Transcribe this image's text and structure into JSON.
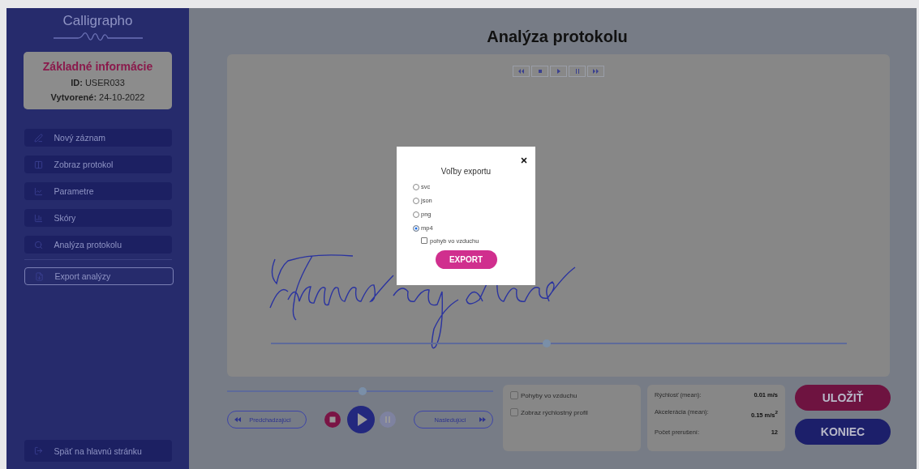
{
  "sidebar": {
    "logo": "Calligrapho",
    "info_card": {
      "title": "Základné informácie",
      "fields": [
        {
          "label": "ID:",
          "value": "USER033"
        },
        {
          "label": "Vytvorené:",
          "value": "24-10-2022"
        }
      ]
    },
    "nav_items": [
      {
        "label": "Nový záznam"
      },
      {
        "label": "Zobraz protokol"
      },
      {
        "label": "Parametre"
      },
      {
        "label": "Skóry"
      },
      {
        "label": "Analýza protokolu"
      }
    ],
    "export_button": "Export analýzy",
    "back_button": "Späť na hlavnú stránku"
  },
  "main": {
    "title": "Analýza protokolu",
    "canvas_slider": {
      "level": 0.48
    },
    "playback": {
      "level": 0.51,
      "previous": "Predchadzajúci",
      "next": "Nasledujúci"
    },
    "options": [
      {
        "label": "Pohyby vo vzduchu",
        "checked": false
      },
      {
        "label": "Zobraz rýchlostný profil",
        "checked": false
      }
    ],
    "stats": [
      {
        "label": "Rýchlosť (mean):",
        "value": "0.01 m/s"
      },
      {
        "label": "Akcelerácia (mean):",
        "value": "0.15 m/s$^{2}$"
      },
      {
        "label": "Počet prerušení:",
        "value": "12"
      }
    ],
    "actions": [
      {
        "label": "ULOŽIŤ",
        "color": "#6e1340"
      },
      {
        "label": "KONIEC",
        "color": "#1c1f6a"
      }
    ]
  },
  "modal": {
    "title": "Voľby exportu",
    "formats": [
      {
        "label": "svc",
        "selected": false
      },
      {
        "label": "json",
        "selected": false
      },
      {
        "label": "png",
        "selected": false
      },
      {
        "label": "mp4",
        "selected": true
      }
    ],
    "sub_option": {
      "label": "pohyb vo vzduchu",
      "checked": false
    },
    "button": "EXPORT"
  }
}
